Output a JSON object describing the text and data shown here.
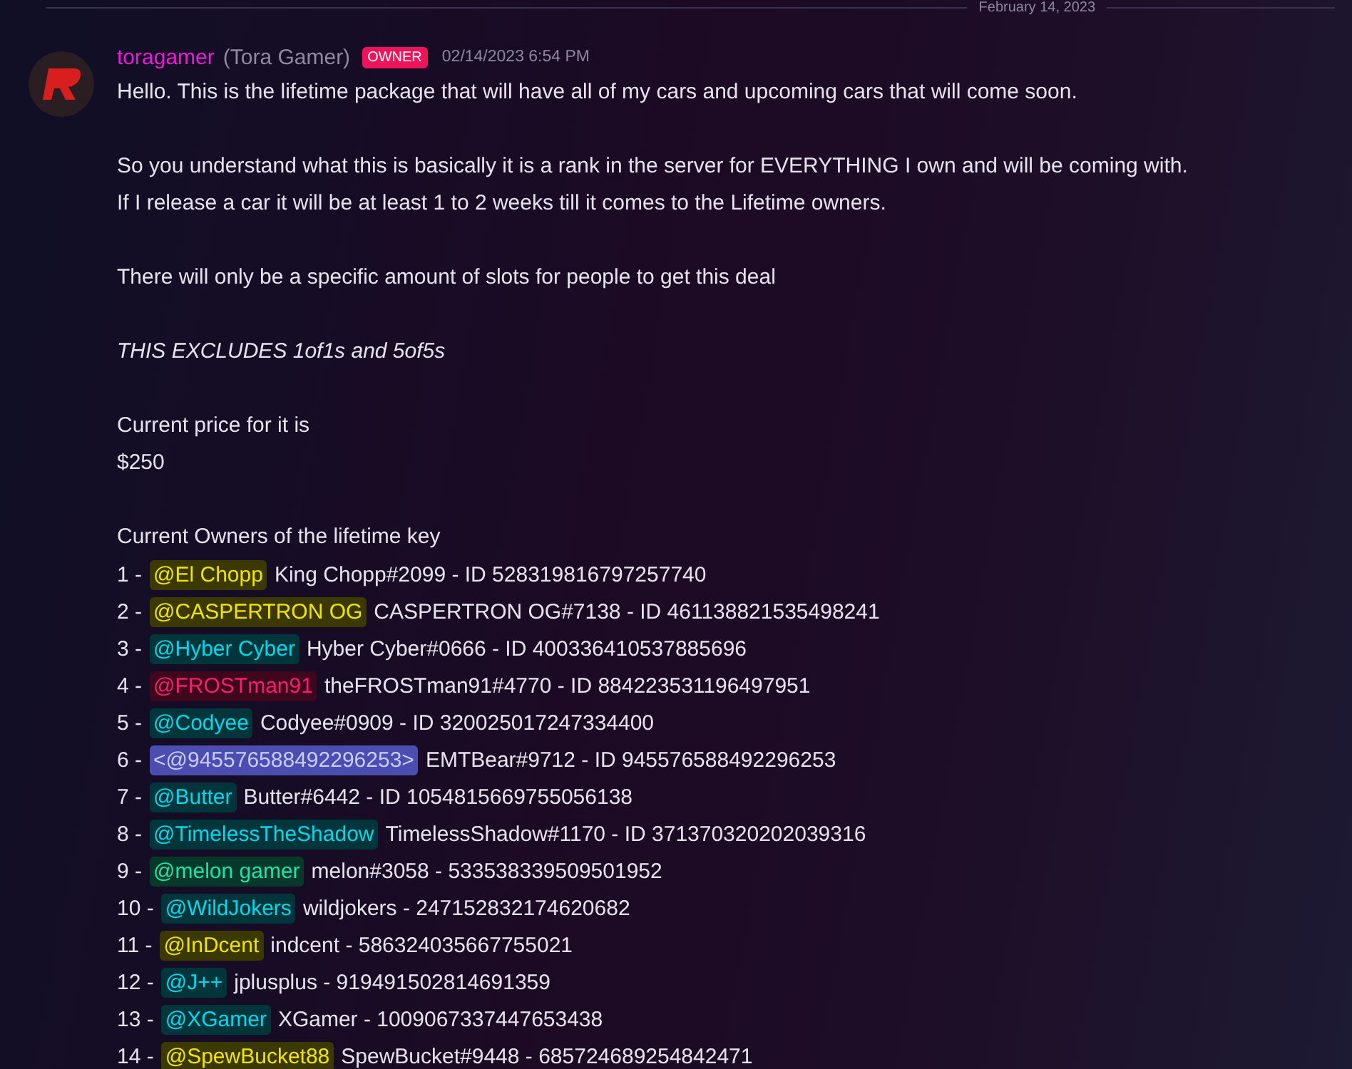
{
  "divider": {
    "date": "February 14, 2023"
  },
  "message": {
    "author": {
      "username": "toragamer",
      "display_name": "(Tora Gamer)",
      "badge": "OWNER",
      "timestamp": "02/14/2023 6:54 PM"
    },
    "blocks": [
      {
        "kind": "text",
        "lines": [
          "Hello. This is the lifetime package that will have all of my cars and upcoming cars that will come soon."
        ]
      },
      {
        "kind": "text",
        "lines": [
          "So you understand what this is basically it is a rank in the server for EVERYTHING I own and will be coming with.",
          "If I release a car it will be at least 1 to 2 weeks till it comes to the Lifetime owners."
        ]
      },
      {
        "kind": "text",
        "lines": [
          "There will only be a specific amount of slots for people to get this deal"
        ]
      },
      {
        "kind": "italic",
        "lines": [
          "THIS EXCLUDES 1of1s and 5of5s"
        ]
      },
      {
        "kind": "text",
        "lines": [
          "Current price for it is",
          "$250"
        ]
      },
      {
        "kind": "text",
        "lines": [
          "Current Owners of the lifetime key"
        ]
      }
    ],
    "owners": [
      {
        "number": "1 -",
        "mention": "@El Chopp",
        "kind": "role",
        "color": "#3c3900",
        "rest": "King Chopp#2099 - ID 528319816797257740"
      },
      {
        "number": "2 -",
        "mention": "@CASPERTRON OG",
        "kind": "role",
        "color": "#3c3900",
        "rest": "CASPERTRON OG#7138 - ID 461138821535498241"
      },
      {
        "number": "3 -",
        "mention": "@Hyber Cyber",
        "kind": "role",
        "color": "#00363b",
        "rest": "Hyber Cyber#0666 - ID 400336410537885696"
      },
      {
        "number": "4 -",
        "mention": "@FROSTman91",
        "kind": "role",
        "color": "#3f071b",
        "rest": "theFROSTman91#4770 - ID 884223531196497951"
      },
      {
        "number": "5 -",
        "mention": "@Codyee",
        "kind": "role",
        "color": "#00363b",
        "rest": "Codyee#0909 - ID 320025017247334400"
      },
      {
        "number": "6 -",
        "mention": "<@945576588492296253>",
        "kind": "raw",
        "color": "#4b4db0",
        "rest": "EMTBear#9712 - ID 945576588492296253"
      },
      {
        "number": "7 -",
        "mention": "@Butter",
        "kind": "role",
        "color": "#00363b",
        "rest": "Butter#6442 - ID 1054815669755056138"
      },
      {
        "number": "8 -",
        "mention": "@TimelessTheShadow",
        "kind": "role",
        "color": "#00363b",
        "rest": "TimelessShadow#1170 - ID 371370320202039316"
      },
      {
        "number": "9 -",
        "mention": "@melon gamer",
        "kind": "role",
        "color": "#07392a",
        "rest": "melon#3058 - 533538339509501952"
      },
      {
        "number": "10 -",
        "mention": "@WildJokers",
        "kind": "role",
        "color": "#00363b",
        "rest": "wildjokers - 247152832174620682"
      },
      {
        "number": "11 -",
        "mention": "@InDcent",
        "kind": "role",
        "color": "#3c3900",
        "rest": "indcent - 586324035667755021"
      },
      {
        "number": "12 -",
        "mention": "@J++",
        "kind": "role",
        "color": "#00363b",
        "rest": "jplusplus - 919491502814691359"
      },
      {
        "number": "13 -",
        "mention": "@XGamer",
        "kind": "role",
        "color": "#00363b",
        "rest": "XGamer - 1009067337447653438"
      },
      {
        "number": "14 -",
        "mention": "@SpewBucket88",
        "kind": "role",
        "color": "#3c3900",
        "rest": "SpewBucket#9448 - 685724689254842471"
      }
    ]
  }
}
